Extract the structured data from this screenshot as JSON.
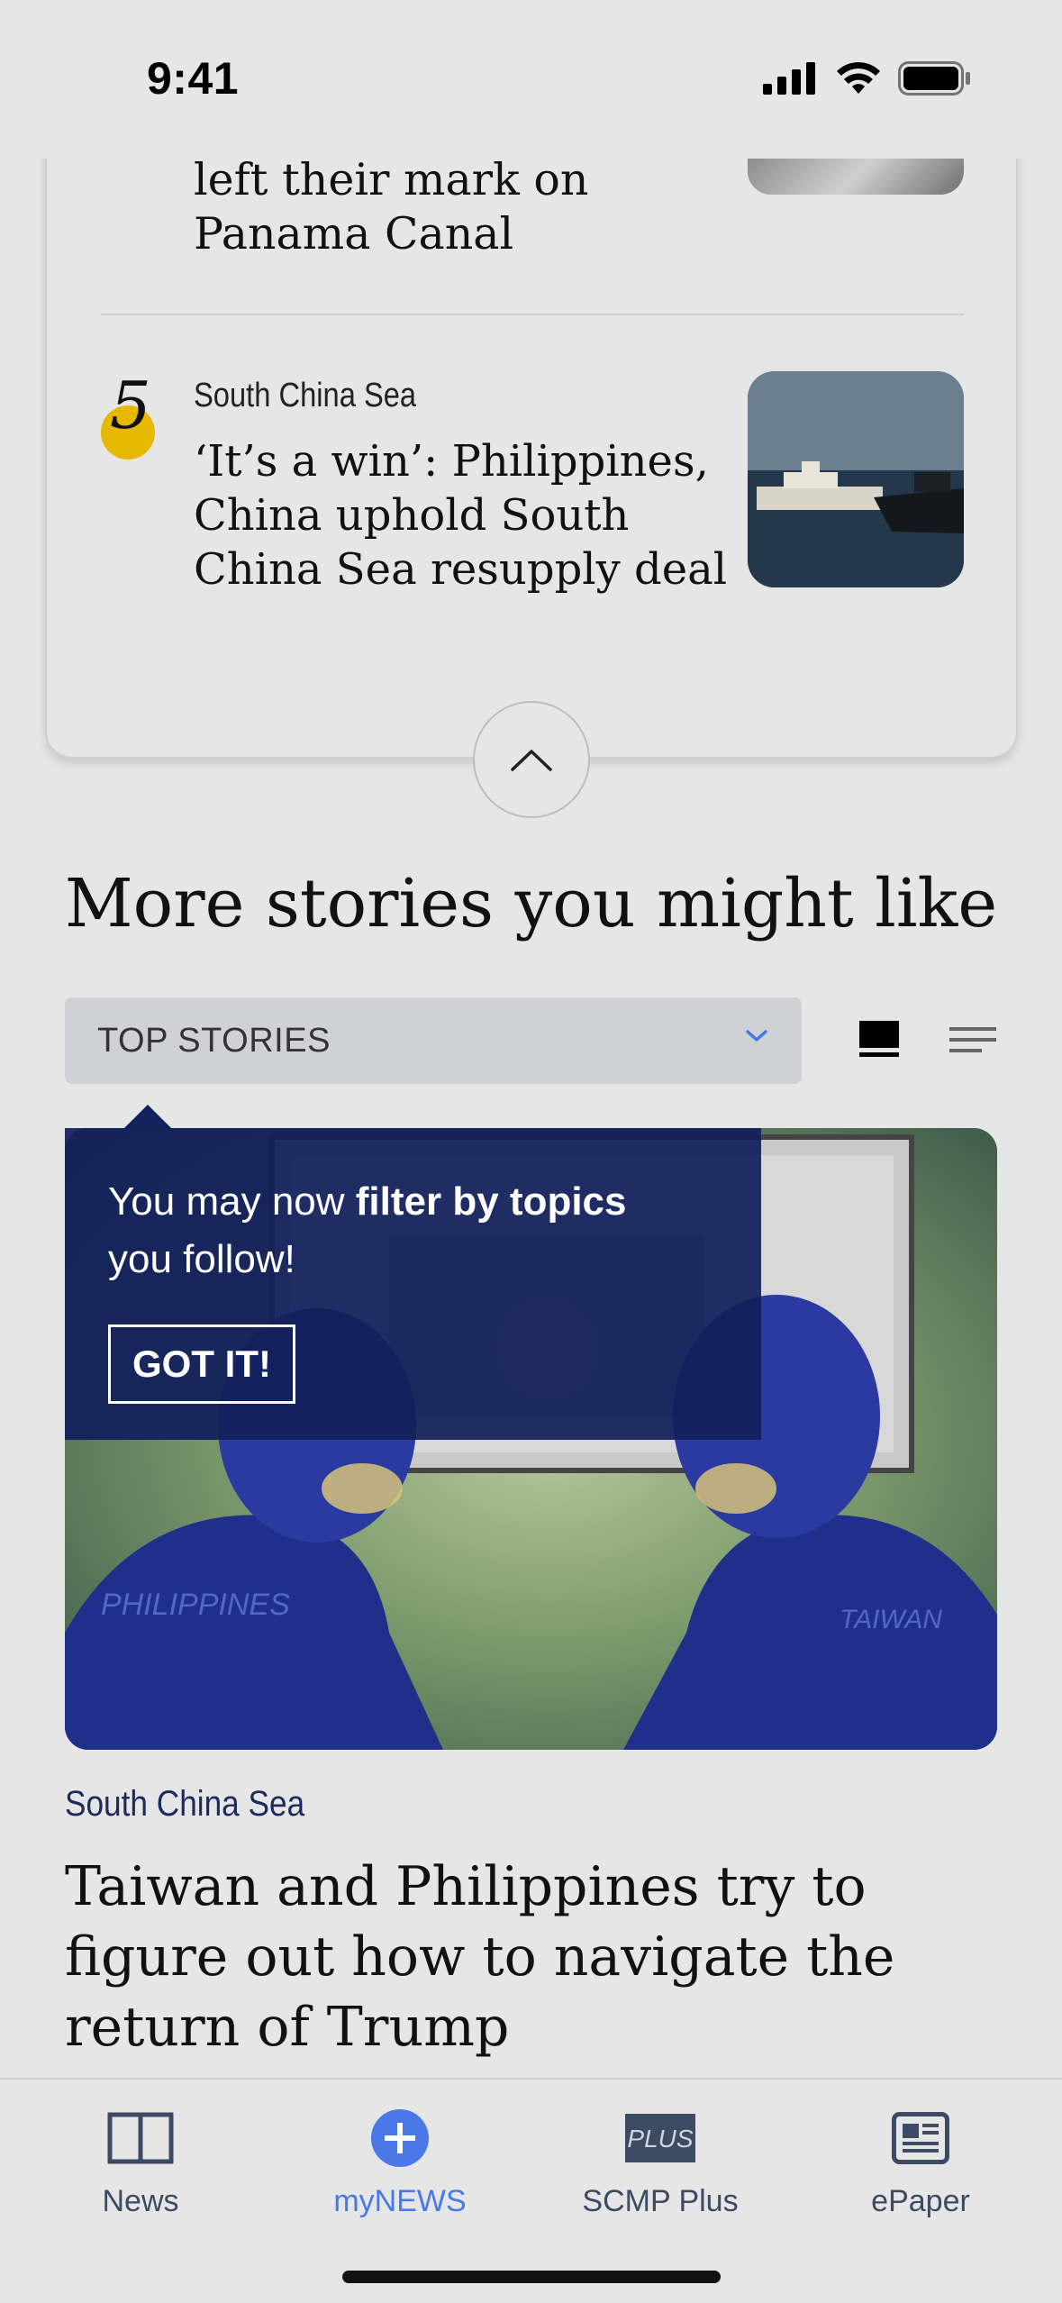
{
  "status_bar": {
    "time": "9:41"
  },
  "trending": {
    "prev_item_headline": "left their mark on Panama Canal",
    "item_rank": "5",
    "item_topic": "South China Sea",
    "item_headline": "‘It’s a win’: Philippines, China uphold South China Sea resupply deal"
  },
  "more_stories": {
    "title": "More stories you might like",
    "filter_value": "TOP STORIES",
    "tooltip": {
      "text_prefix": "You may now ",
      "text_bold": "filter by topics",
      "text_suffix": " you follow!",
      "button": "GOT IT!"
    },
    "feature": {
      "topic": "South China Sea",
      "headline": "Taiwan and Philippines try to figure out how to navigate the return of Trump",
      "image_labels": {
        "left": "PHILIPPINES",
        "right": "TAIWAN"
      }
    }
  },
  "bottom_nav": {
    "items": [
      {
        "label": "News",
        "icon": "book-icon"
      },
      {
        "label": "myNEWS",
        "icon": "plus-circle-icon",
        "active": true
      },
      {
        "label": "SCMP Plus",
        "icon": "plus-badge-icon",
        "badge": "PLUS"
      },
      {
        "label": "ePaper",
        "icon": "newspaper-icon"
      }
    ]
  },
  "colors": {
    "accent": "#4a78e8",
    "tooltip_bg": "#111f5a",
    "rank_dot": "#e6b800"
  }
}
